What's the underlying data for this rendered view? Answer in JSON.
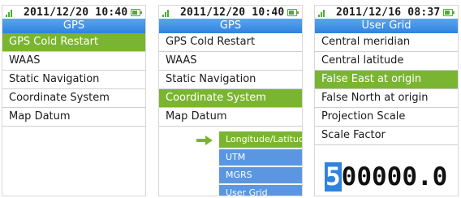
{
  "screens": [
    {
      "clock": "2011/12/20 10:40",
      "title": "GPS",
      "menu": [
        "GPS Cold Restart",
        "WAAS",
        "Static Navigation",
        "Coordinate System",
        "Map Datum"
      ]
    },
    {
      "clock": "2011/12/20 10:40",
      "title": "GPS",
      "menu": [
        "GPS Cold Restart",
        "WAAS",
        "Static Navigation",
        "Coordinate System",
        "Map Datum"
      ],
      "submenu": [
        "Longitude/Latitude",
        "UTM",
        "MGRS",
        "User Grid"
      ]
    },
    {
      "clock": "2011/12/16 08:37",
      "title": "User Grid",
      "menu": [
        "Central meridian",
        "Central latitude",
        "False East at origin",
        "False North at origin",
        "Projection Scale",
        "Scale Factor"
      ],
      "value": {
        "cursor_digit": "5",
        "rest": "00000.0"
      }
    }
  ],
  "colors": {
    "accent_green": "#7ab532",
    "title_blue": "#2f83df",
    "submenu_blue": "#5b97e0"
  },
  "battery_level": 0.6
}
